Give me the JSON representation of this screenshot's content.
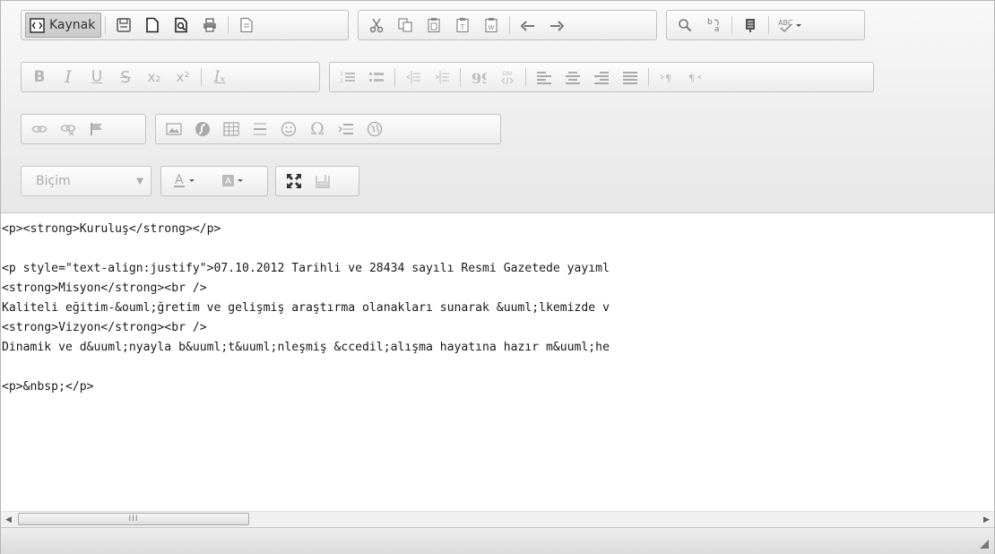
{
  "toolbar": {
    "source_label": "Kaynak",
    "format_combo": {
      "label": "Biçim"
    },
    "row1": {
      "document": [
        "save-icon",
        "new-page-icon",
        "preview-icon",
        "print-icon",
        "templates-icon"
      ],
      "clipboard": [
        "cut-icon",
        "copy-icon",
        "paste-icon",
        "paste-text-icon",
        "paste-word-icon",
        "undo-icon",
        "redo-icon"
      ],
      "editing": [
        "find-icon",
        "replace-icon",
        "select-all-icon",
        "spellcheck-icon"
      ]
    },
    "row2": {
      "basic": [
        "B",
        "I",
        "U",
        "S",
        "x₂",
        "x²",
        "Iₓ"
      ],
      "paragraph": [
        "numbered-list-icon",
        "bulleted-list-icon",
        "outdent-icon",
        "indent-icon",
        "blockquote-icon",
        "create-div-icon",
        "align-left-icon",
        "align-center-icon",
        "align-right-icon",
        "justify-icon",
        "ltr-icon",
        "rtl-icon"
      ]
    },
    "row3": {
      "links": [
        "link-icon",
        "unlink-icon",
        "anchor-icon"
      ],
      "insert": [
        "image-icon",
        "flash-icon",
        "table-icon",
        "horizontal-rule-icon",
        "smiley-icon",
        "Ω",
        "page-break-icon",
        "iframe-icon"
      ]
    },
    "row4": {
      "colors": [
        "text-color-icon",
        "background-color-icon"
      ],
      "tools": [
        "maximize-icon",
        "show-blocks-icon"
      ]
    }
  },
  "source": {
    "lines": [
      "<p><strong>Kuruluş</strong></p>",
      "",
      "<p style=\"text-align:justify\">07.10.2012 Tarihli ve 28434 sayılı Resmi Gazetede yayıml",
      "<strong>Misyon</strong><br />",
      "Kaliteli eğitim-&ouml;ğretim ve gelişmiş araştırma olanakları sunarak &uuml;lkemizde v",
      "<strong>Vizyon</strong><br />",
      "Dinamik ve d&uuml;nyayla b&uuml;t&uuml;nleşmiş &ccedil;alışma hayatına hazır m&uuml;he",
      "",
      "<p>&nbsp;</p>"
    ]
  },
  "scrollbar": {
    "grip": "III"
  }
}
